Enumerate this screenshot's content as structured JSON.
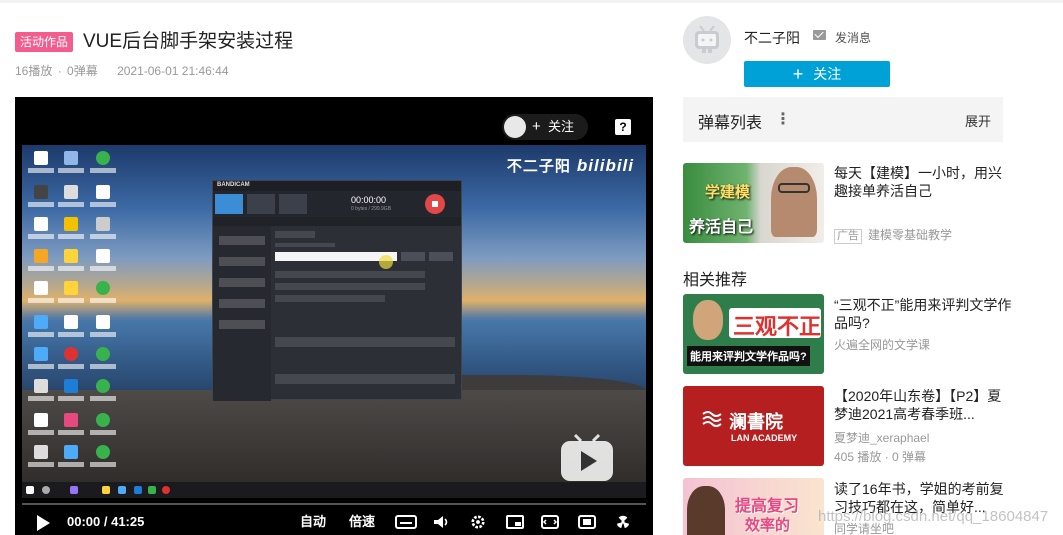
{
  "video": {
    "tag": "活动作品",
    "title": "VUE后台脚手架安装过程",
    "plays": "16播放",
    "danmaku_count": "0弹幕",
    "date": "2021-06-01 21:46:44"
  },
  "player": {
    "follow_label": "关注",
    "help": "?",
    "watermark_name": "不二子阳",
    "watermark_logo": "bilibili",
    "time_current": "00:00",
    "time_total": "41:25",
    "quality": "自动",
    "speed": "倍速",
    "bandicam": {
      "brand": "BANDICAM",
      "timer": "00:00:00",
      "size": "0 bytes / 299.9GB"
    },
    "icons": [
      "play-icon",
      "subtitle-icon",
      "volume-icon",
      "settings-icon",
      "pip-icon",
      "widescreen-icon",
      "fullscreen-icon",
      "radiation-icon",
      "tv-logo-icon"
    ]
  },
  "uploader": {
    "name": "不二子阳",
    "message": "发消息",
    "follow": "关注"
  },
  "danmaku_list": {
    "title": "弹幕列表",
    "expand": "展开"
  },
  "ad": {
    "title": "每天【建模】一小时，用兴趣接单养活自己",
    "badge": "广告",
    "source": "建模零基础教学",
    "thumb_text": [
      "学建模",
      "养活自己"
    ]
  },
  "recommend": {
    "title": "相关推荐",
    "items": [
      {
        "title": "“三观不正”能用来评判文学作品吗?",
        "author": "火遍全网的文学课",
        "stats": "",
        "thumb_text": [
          "三观不正",
          "能用来评判文学作品吗?"
        ]
      },
      {
        "title": "【2020年山东卷】【P2】夏梦迪2021高考春季班...",
        "author": "夏梦迪_xeraphael",
        "stats": "405 播放 · 0 弹幕",
        "thumb_text": [
          "澜書院",
          "LAN ACADEMY"
        ]
      },
      {
        "title": "读了16年书，学姐的考前复习技巧都在这，简单好...",
        "author": "同学请坐吧",
        "stats": "",
        "thumb_text": [
          "提高复习",
          "效率的"
        ]
      }
    ]
  },
  "page_watermark": "https://blog.csdn.net/qq_18604847"
}
